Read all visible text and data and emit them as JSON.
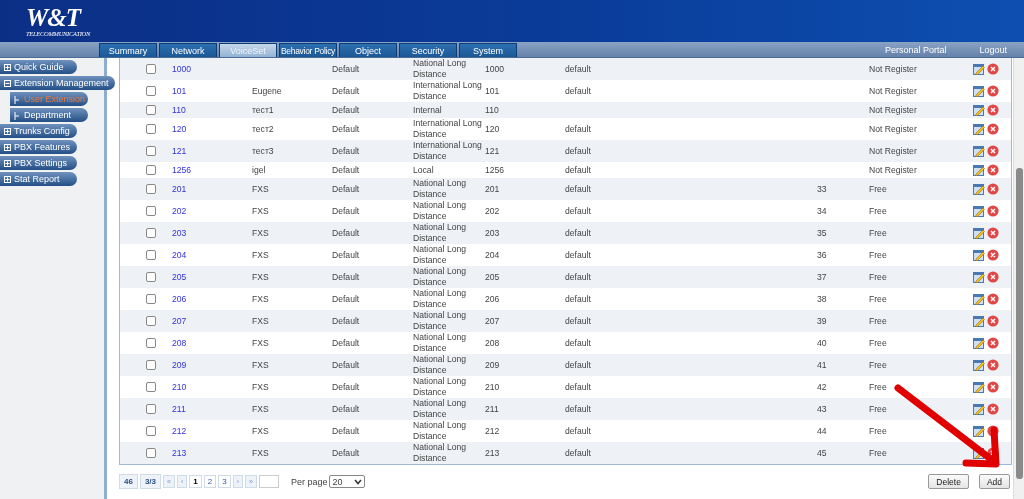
{
  "header": {
    "logo": "W&T",
    "logo_subtitle": "TELECOMMUNICATION"
  },
  "tabs": [
    {
      "label": "Summary",
      "selected": false
    },
    {
      "label": "Network",
      "selected": false
    },
    {
      "label": "VoiceSet",
      "selected": true
    },
    {
      "label": "Behavior Policy",
      "selected": false
    },
    {
      "label": "Object",
      "selected": false
    },
    {
      "label": "Security",
      "selected": false
    },
    {
      "label": "System",
      "selected": false
    }
  ],
  "top_links": [
    "Personal Portal",
    "Logout"
  ],
  "sidebar": {
    "items": [
      {
        "label": "Quick Guide",
        "expanded": false
      },
      {
        "label": "Extension Management",
        "expanded": true,
        "children": [
          {
            "label": "User Extension",
            "selected": true
          },
          {
            "label": "Department",
            "selected": false
          }
        ]
      },
      {
        "label": "Trunks Config",
        "expanded": false
      },
      {
        "label": "PBX Features",
        "expanded": false
      },
      {
        "label": "PBX Settings",
        "expanded": false
      },
      {
        "label": "Stat Report",
        "expanded": false
      }
    ]
  },
  "table": {
    "rows": [
      {
        "checked": false,
        "number": "1000",
        "group": "Default",
        "call_level": "National Long Distance",
        "extension": "1000",
        "profile": "default",
        "status": "Not Register"
      },
      {
        "checked": false,
        "number": "101",
        "name": "Eugene",
        "group": "Default",
        "call_level": "International Long Distance",
        "extension": "101",
        "profile": "default",
        "status": "Not Register"
      },
      {
        "checked": false,
        "number": "110",
        "name": "тест1",
        "group": "Default",
        "call_level": "Internal",
        "extension": "110",
        "status": "Not Register"
      },
      {
        "checked": false,
        "number": "120",
        "name": "тест2",
        "group": "Default",
        "call_level": "International Long Distance",
        "extension": "120",
        "profile": "default",
        "status": "Not Register"
      },
      {
        "checked": false,
        "number": "121",
        "name": "тест3",
        "group": "Default",
        "call_level": "International Long Distance",
        "extension": "121",
        "profile": "default",
        "status": "Not Register"
      },
      {
        "checked": false,
        "number": "1256",
        "name": "igel",
        "group": "Default",
        "call_level": "Local",
        "extension": "1256",
        "profile": "default",
        "status": "Not Register"
      },
      {
        "checked": false,
        "number": "201",
        "name": "FXS",
        "group": "Default",
        "call_level": "National Long Distance",
        "extension": "201",
        "profile": "default",
        "port": "33",
        "status": "Free"
      },
      {
        "checked": false,
        "number": "202",
        "name": "FXS",
        "group": "Default",
        "call_level": "National Long Distance",
        "extension": "202",
        "profile": "default",
        "port": "34",
        "status": "Free"
      },
      {
        "checked": false,
        "number": "203",
        "name": "FXS",
        "group": "Default",
        "call_level": "National Long Distance",
        "extension": "203",
        "profile": "default",
        "port": "35",
        "status": "Free"
      },
      {
        "checked": false,
        "number": "204",
        "name": "FXS",
        "group": "Default",
        "call_level": "National Long Distance",
        "extension": "204",
        "profile": "default",
        "port": "36",
        "status": "Free"
      },
      {
        "checked": false,
        "number": "205",
        "name": "FXS",
        "group": "Default",
        "call_level": "National Long Distance",
        "extension": "205",
        "profile": "default",
        "port": "37",
        "status": "Free"
      },
      {
        "checked": false,
        "number": "206",
        "name": "FXS",
        "group": "Default",
        "call_level": "National Long Distance",
        "extension": "206",
        "profile": "default",
        "port": "38",
        "status": "Free"
      },
      {
        "checked": false,
        "number": "207",
        "name": "FXS",
        "group": "Default",
        "call_level": "National Long Distance",
        "extension": "207",
        "profile": "default",
        "port": "39",
        "status": "Free"
      },
      {
        "checked": false,
        "number": "208",
        "name": "FXS",
        "group": "Default",
        "call_level": "National Long Distance",
        "extension": "208",
        "profile": "default",
        "port": "40",
        "status": "Free"
      },
      {
        "checked": false,
        "number": "209",
        "name": "FXS",
        "group": "Default",
        "call_level": "National Long Distance",
        "extension": "209",
        "profile": "default",
        "port": "41",
        "status": "Free"
      },
      {
        "checked": false,
        "number": "210",
        "name": "FXS",
        "group": "Default",
        "call_level": "National Long Distance",
        "extension": "210",
        "profile": "default",
        "port": "42",
        "status": "Free"
      },
      {
        "checked": false,
        "number": "211",
        "name": "FXS",
        "group": "Default",
        "call_level": "National Long Distance",
        "extension": "211",
        "profile": "default",
        "port": "43",
        "status": "Free"
      },
      {
        "checked": false,
        "number": "212",
        "name": "FXS",
        "group": "Default",
        "call_level": "National Long Distance",
        "extension": "212",
        "profile": "default",
        "port": "44",
        "status": "Free"
      },
      {
        "checked": false,
        "number": "213",
        "name": "FXS",
        "group": "Default",
        "call_level": "National Long Distance",
        "extension": "213",
        "profile": "default",
        "port": "45",
        "status": "Free"
      }
    ]
  },
  "pagination": {
    "total": "46",
    "page_of": "3/3",
    "first": "«",
    "prev": "‹",
    "pages": [
      {
        "label": "1",
        "selected": true
      },
      {
        "label": "2",
        "selected": false
      },
      {
        "label": "3",
        "selected": false
      }
    ],
    "next": "›",
    "last": "»",
    "per_page_label": "Per page",
    "per_page": "20"
  },
  "buttons": [
    "Delete",
    "Add"
  ]
}
